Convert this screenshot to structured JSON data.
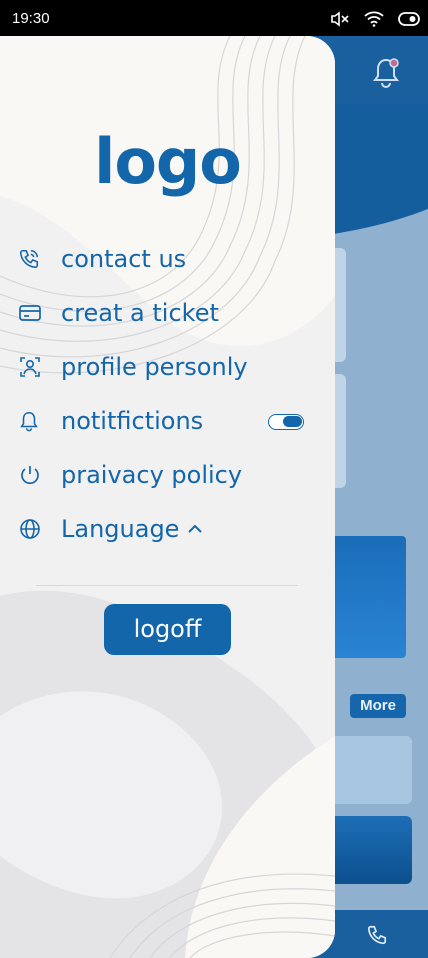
{
  "status_bar": {
    "time": "19:30"
  },
  "drawer": {
    "logo_text": "logo",
    "menu": [
      {
        "label": "contact us",
        "icon": "phone-icon"
      },
      {
        "label": "creat a ticket",
        "icon": "ticket-card-icon"
      },
      {
        "label": "profile personly",
        "icon": "profile-icon"
      },
      {
        "label": "notitfictions",
        "icon": "bell-icon"
      },
      {
        "label": "praivacy policy",
        "icon": "power-icon"
      },
      {
        "label": "Language",
        "icon": "globe-icon"
      }
    ],
    "notifications_toggle_on": true,
    "logoff_label": "logoff"
  },
  "background": {
    "more_label": "More"
  },
  "colors": {
    "accent": "#1466aa",
    "drawer_bg": "#f1f1f2",
    "overlay": "#8fb1cf"
  }
}
